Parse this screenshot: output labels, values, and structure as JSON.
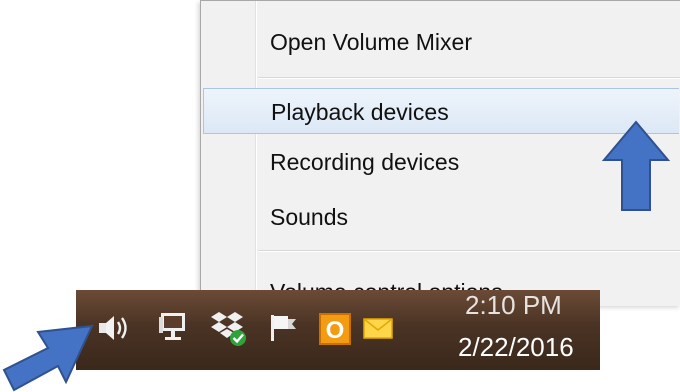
{
  "menu": {
    "items": [
      {
        "label": "Open Volume Mixer"
      },
      {
        "label": "Playback devices",
        "highlighted": true
      },
      {
        "label": "Recording devices"
      },
      {
        "label": "Sounds"
      },
      {
        "label": "Volume control options"
      }
    ]
  },
  "taskbar": {
    "tray_icons": [
      "speaker-icon",
      "network-icon",
      "dropbox-icon",
      "action-center-flag-icon",
      "outlook-icon",
      "mail-envelope-icon"
    ],
    "clock_time": "2:10 PM",
    "clock_date": "2/22/2016"
  },
  "annotations": {
    "arrow_color": "#4472c4",
    "arrows": [
      "up-arrow",
      "diagonal-arrow"
    ]
  }
}
